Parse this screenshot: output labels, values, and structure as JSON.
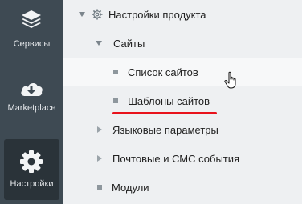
{
  "sidebar": {
    "items": [
      {
        "label": "Сервисы",
        "icon": "layers-icon"
      },
      {
        "label": "Marketplace",
        "icon": "cloud-download-icon"
      },
      {
        "label": "Настройки",
        "icon": "gear-icon"
      }
    ]
  },
  "tree": {
    "root": {
      "label": "Настройки продукта",
      "icon": "gear-icon"
    },
    "sites": {
      "label": "Сайты"
    },
    "site_list": {
      "label": "Список сайтов"
    },
    "site_templates": {
      "label": "Шаблоны сайтов"
    },
    "language": {
      "label": "Языковые параметры"
    },
    "mail_sms": {
      "label": "Почтовые и СМС события"
    },
    "modules": {
      "label": "Модули"
    }
  },
  "colors": {
    "sidebar_bg": "#3e4a53",
    "sidebar_active_bg": "#2a3339",
    "highlight_underline": "#e8121b"
  }
}
